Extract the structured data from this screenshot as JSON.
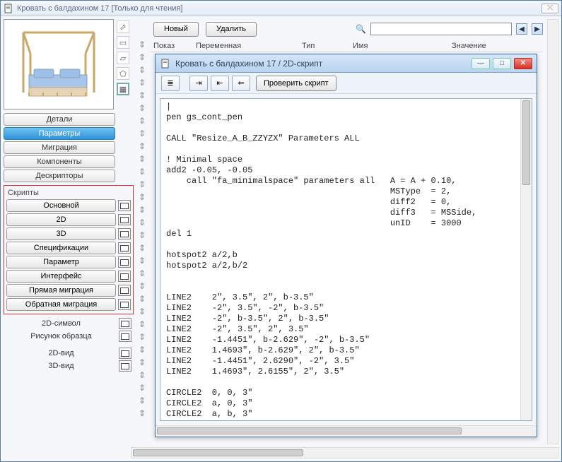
{
  "window": {
    "title": "Кровать с балдахином 17 [Только для чтения]",
    "close_glyph": "⤬"
  },
  "toolbar": {
    "new_label": "Новый",
    "delete_label": "Удалить",
    "search_placeholder": "",
    "search_icon": "🔍",
    "prev_glyph": "◀",
    "next_glyph": "▶"
  },
  "headers": {
    "h1": "Показ",
    "h2": "Переменная",
    "h3": "Тип",
    "h4": "Имя",
    "h5": "Значение"
  },
  "left": {
    "nav": [
      "Детали",
      "Параметры",
      "Миграция",
      "Компоненты",
      "Дескрипторы"
    ],
    "active_index": 1,
    "scripts_title": "Скрипты",
    "scripts": [
      "Основной",
      "2D",
      "3D",
      "Спецификации",
      "Параметр",
      "Интерфейс",
      "Прямая миграция",
      "Обратная миграция"
    ],
    "extras": [
      "2D-символ",
      "Рисунок образца",
      "2D-вид",
      "3D-вид"
    ],
    "icon_glyphs": [
      "⬀",
      "▭",
      "▱",
      "⬠",
      "▦"
    ]
  },
  "inner_window": {
    "title": "Кровать с балдахином 17 / 2D-скрипт",
    "check_label": "Проверить скрипт",
    "itb_glyphs": [
      "≣",
      "⇥",
      "⇤",
      "⇐"
    ],
    "min_glyph": "—",
    "max_glyph": "□",
    "close_glyph": "✕"
  },
  "script_text": "|\npen gs_cont_pen\n\nCALL \"Resize_A_B_ZZYZX\" Parameters ALL\n\n! Minimal space\nadd2 -0.05, -0.05\n    call \"fa_minimalspace\" parameters all   A = A + 0.10,\n                                            MSType  = 2,\n                                            diff2   = 0,\n                                            diff3   = MSSide,\n                                            unID    = 3000\ndel 1\n\nhotspot2 a/2,b\nhotspot2 a/2,b/2\n\n\nLINE2    2\", 3.5\", 2\", b-3.5\"\nLINE2    -2\", 3.5\", -2\", b-3.5\"\nLINE2    -2\", b-3.5\", 2\", b-3.5\"\nLINE2    -2\", 3.5\", 2\", 3.5\"\nLINE2    -1.4451\", b-2.629\", -2\", b-3.5\"\nLINE2    1.4693\", b-2.629\", 2\", b-3.5\"\nLINE2    -1.4451\", 2.6290\", -2\", 3.5\"\nLINE2    1.4693\", 2.6155\", 2\", 3.5\"\n\nCIRCLE2  0, 0, 3\"\nCIRCLE2  a, 0, 3\"\nCIRCLE2  a, b, 3\""
}
